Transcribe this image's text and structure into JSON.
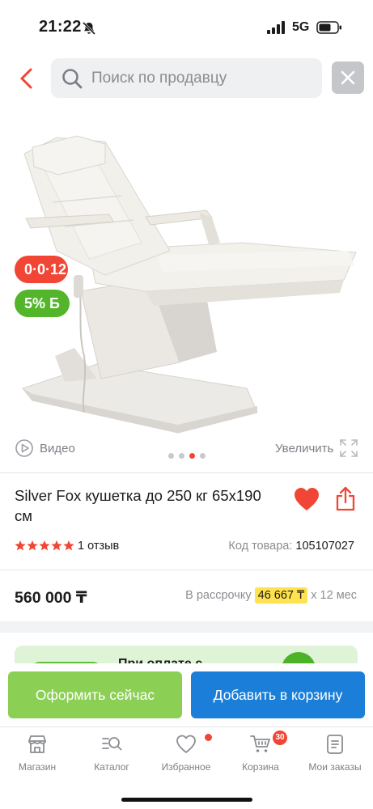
{
  "status_bar": {
    "time": "21:22",
    "network": "5G",
    "icons": [
      "bell-mute-icon",
      "signal-icon",
      "battery-icon"
    ]
  },
  "header": {
    "search_placeholder": "Поиск по продавцу",
    "icons": [
      "chevron-left-icon",
      "search-icon",
      "close-icon"
    ],
    "accent_color": "#f14635"
  },
  "gallery": {
    "badge_installment": "0·0·12",
    "badge_bonus": "5% Б",
    "video_label": "Видео",
    "zoom_label": "Увеличить",
    "slides_total": 4,
    "active_slide": 3
  },
  "product": {
    "title": "Silver Fox кушетка до 250 кг 65х190 см",
    "rating_stars": 5,
    "reviews": "1 отзыв",
    "sku_label": "Код товара:",
    "sku_value": "105107027",
    "price": "560 000 ₸",
    "installment_prefix": "В рассрочку",
    "installment_amount": "46 667 ₸",
    "installment_suffix": "х 12 мес",
    "favorite": true
  },
  "promo": {
    "text": "При оплате с"
  },
  "actions": {
    "buy_now": "Оформить сейчас",
    "add_to_cart": "Добавить в корзину",
    "buy_color": "#8ccf55",
    "cart_color": "#1b7ed8"
  },
  "tabbar": {
    "items": [
      {
        "label": "Магазин",
        "icon": "shop-icon"
      },
      {
        "label": "Каталог",
        "icon": "catalog-search-icon"
      },
      {
        "label": "Избранное",
        "icon": "heart-icon"
      },
      {
        "label": "Корзина",
        "icon": "cart-icon"
      },
      {
        "label": "Мои заказы",
        "icon": "orders-icon"
      }
    ],
    "cart_count": "30"
  }
}
